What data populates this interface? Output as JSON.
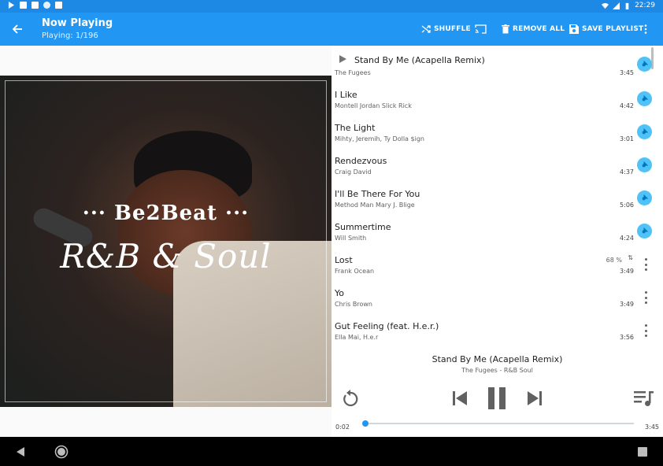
{
  "status_bar": {
    "time": "22:29"
  },
  "app_bar": {
    "title": "Now Playing",
    "subtitle": "Playing: 1/196",
    "actions": {
      "shuffle": "SHUFFLE",
      "remove_all": "REMOVE ALL",
      "save_playlist": "SAVE PLAYLIST"
    }
  },
  "album_art": {
    "brand": "··· Be2Beat ···",
    "genre": "R&B & Soul"
  },
  "queue": [
    {
      "title": "Stand By Me (Acapella Remix)",
      "artist": "The Fugees",
      "duration": "3:45",
      "playing": true,
      "pinned": true
    },
    {
      "title": "I Like",
      "artist": "Montell Jordan  Slick Rick",
      "duration": "4:42",
      "pinned": true
    },
    {
      "title": "The Light",
      "artist": "Mihty, Jeremih, Ty Dolla $ign",
      "duration": "3:01",
      "pinned": true
    },
    {
      "title": "Rendezvous",
      "artist": "Craig David",
      "duration": "4:37",
      "pinned": true
    },
    {
      "title": "I'll Be There For You",
      "artist": "Method Man  Mary J. Blige",
      "duration": "5:06",
      "pinned": true
    },
    {
      "title": "Summertime",
      "artist": "Will Smith",
      "duration": "4:24",
      "pinned": true
    },
    {
      "title": "Lost",
      "artist": "Frank Ocean",
      "duration": "3:49",
      "download_progress": "68 %",
      "sync_glyph": "⇅"
    },
    {
      "title": "Yo",
      "artist": "Chris Brown",
      "duration": "3:49"
    },
    {
      "title": "Gut Feeling (feat. H.e.r.)",
      "artist": "Ella Mai, H.e.r",
      "duration": "3:56"
    }
  ],
  "now_playing": {
    "title": "Stand By Me (Acapella Remix)",
    "subtitle": "The Fugees - R&B Soul",
    "elapsed": "0:02",
    "total": "3:45",
    "progress": 0.009
  },
  "colors": {
    "primary": "#2196f3",
    "status": "#1e88e5",
    "pin": "#4fc3f7"
  }
}
